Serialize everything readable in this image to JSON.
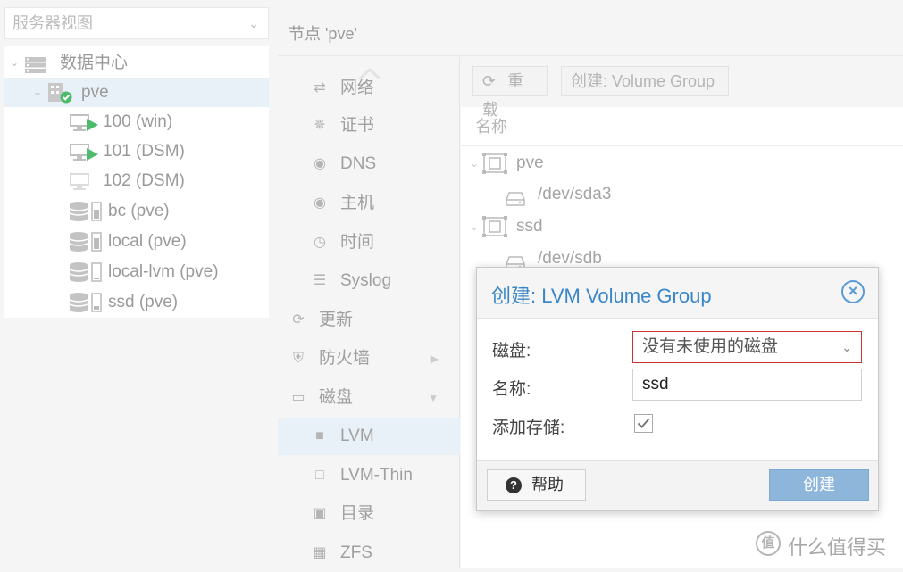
{
  "left": {
    "view_selector": "服务器视图",
    "tree": [
      {
        "label": "数据中心",
        "icon": "datacenter-icon"
      },
      {
        "label": "pve",
        "icon": "node-icon"
      },
      {
        "label": "100 (win)",
        "icon": "vm-running-icon"
      },
      {
        "label": "101 (DSM)",
        "icon": "vm-running-icon"
      },
      {
        "label": "102 (DSM)",
        "icon": "vm-stopped-icon"
      },
      {
        "label": "bc (pve)",
        "icon": "storage-icon"
      },
      {
        "label": "local (pve)",
        "icon": "storage-icon"
      },
      {
        "label": "local-lvm (pve)",
        "icon": "storage-icon"
      },
      {
        "label": "ssd (pve)",
        "icon": "storage-icon"
      }
    ]
  },
  "header": {
    "title": "节点 'pve'"
  },
  "menu": [
    {
      "label": "网络",
      "icon": "network-icon"
    },
    {
      "label": "证书",
      "icon": "certificate-icon"
    },
    {
      "label": "DNS",
      "icon": "globe-icon"
    },
    {
      "label": "主机",
      "icon": "globe-icon"
    },
    {
      "label": "时间",
      "icon": "clock-icon"
    },
    {
      "label": "Syslog",
      "icon": "list-icon"
    },
    {
      "label": "更新",
      "icon": "refresh-icon"
    },
    {
      "label": "防火墙",
      "icon": "shield-icon"
    },
    {
      "label": "磁盘",
      "icon": "drive-icon"
    },
    {
      "label": "LVM",
      "icon": "square-icon"
    },
    {
      "label": "LVM-Thin",
      "icon": "square-outline-icon"
    },
    {
      "label": "目录",
      "icon": "folder-icon"
    },
    {
      "label": "ZFS",
      "icon": "grid-icon"
    }
  ],
  "toolbar": {
    "reload": "重载",
    "create": "创建: Volume Group"
  },
  "grid": {
    "column": "名称",
    "rows": [
      {
        "label": "pve",
        "kind": "group"
      },
      {
        "label": "/dev/sda3",
        "kind": "disk"
      },
      {
        "label": "ssd",
        "kind": "group"
      },
      {
        "label": "/dev/sdb",
        "kind": "disk"
      }
    ]
  },
  "dialog": {
    "title": "创建: LVM Volume Group",
    "disk_label": "磁盘:",
    "disk_value": "没有未使用的磁盘",
    "name_label": "名称:",
    "name_value": "ssd",
    "add_storage_label": "添加存储:",
    "add_storage_checked": true,
    "help": "帮助",
    "create": "创建"
  },
  "watermark": {
    "text": "什么值得买",
    "glyph": "值"
  },
  "colors": {
    "accent": "#3a87c7",
    "selection": "#e9f1f8",
    "primary_button": "#8eb6db",
    "invalid_border": "#cc3333",
    "running_green": "#4cbb6c"
  }
}
